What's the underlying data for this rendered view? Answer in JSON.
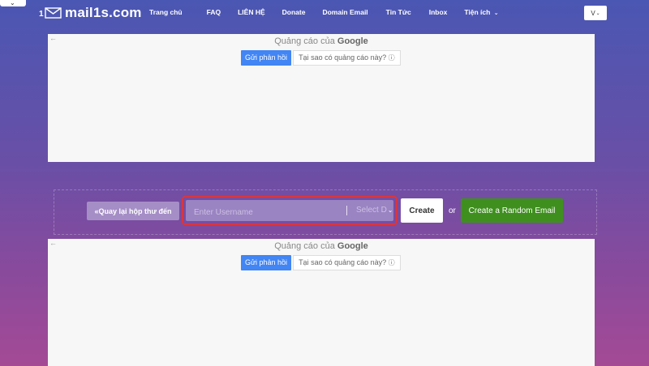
{
  "header": {
    "brand": "mail1s.com",
    "nav": [
      {
        "label": "Trang chủ",
        "x": 0
      },
      {
        "label": "FAQ"
      },
      {
        "label": "LIÊN HỆ"
      },
      {
        "label": "Donate"
      },
      {
        "label": "Domain Email"
      },
      {
        "label": "Tin Tức"
      },
      {
        "label": "Inbox"
      },
      {
        "label": "Tiện ích"
      }
    ],
    "lang_label": "V"
  },
  "ads": {
    "header_prefix": "Quảng cáo của",
    "header_brand": "Google",
    "feedback_label": "Gửi phản hồi",
    "why_label": "Tại sao có quảng cáo này?"
  },
  "form": {
    "back_label": "«Quay lại hộp thư đến",
    "username_placeholder": "Enter Username",
    "username_value": "",
    "domain_selected": "Select D",
    "create_label": "Create",
    "or_label": "or",
    "random_label": "Create a Random Email"
  },
  "colors": {
    "accent_blue": "#4285f4",
    "random_green": "#3f8f1f",
    "highlight_red": "#d9363e"
  }
}
